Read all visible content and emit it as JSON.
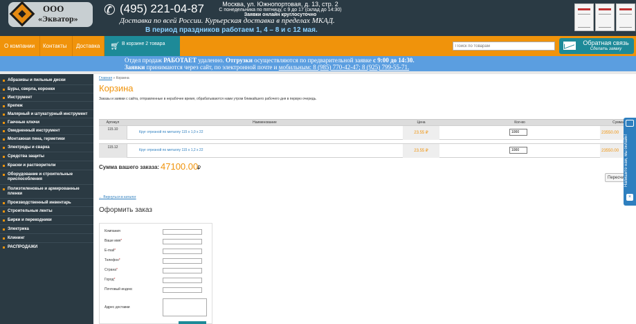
{
  "header": {
    "logo_ooo": "ООО",
    "logo_name": "«Экватор»",
    "phone": "(495) 221-04-87",
    "delivery": "Доставка по всей России.  Курьерская доставка в пределах МКАД.",
    "address": "Москва, ул. Южнопортовая, д. 13, стр. 2",
    "hours": "С понедельника по пятницу, с 9 до 17 (склад до 14:30)",
    "online": "Заявки онлайн круглосуточно",
    "holiday": "В период праздников работаем   1, 4 – 8 и с 12 мая."
  },
  "nav": {
    "items": [
      "О компании",
      "Контакты",
      "Доставка"
    ],
    "cart_label": "В корзине 2 товара",
    "search_placeholder": "Поиск по товарам",
    "feedback_title": "Обратная связь",
    "feedback_sub": "Сделать заявку"
  },
  "notice": {
    "l1_a": "Отдел продаж ",
    "l1_b": "РАБОТАЕТ",
    "l1_c": " удаленно.    ",
    "l1_d": "Отгрузки",
    "l1_e": " осуществляются по предварительной заявке ",
    "l1_f": "с 9:00 до 14:30.",
    "l2_a": "Заявки",
    "l2_b": " принимаются через сайт, по электронной почте и ",
    "l2_c": "мобильным: 8 (985) 770-42-47;   8 (925) 799-55-71."
  },
  "sidebar": {
    "items": [
      "Абразивы и пильные диски",
      "Буры, сверла, коронки",
      "Инструмент",
      "Крепеж",
      "Малярный и штукатурный инструмент",
      "Гаечные ключи",
      "Омедненный инструмент",
      "Монтажная пена, герметики",
      "Электроды и сварка",
      "Средства защиты",
      "Краски и растворители",
      "Оборудование и строительные приспособления",
      "Полиэтиленовые и армированные пленки",
      "Производственный инвентарь",
      "Строительные ленты",
      "Бирки и перекодники",
      "Электрика",
      "Клининг",
      "РАСПРОДАЖИ"
    ]
  },
  "main": {
    "breadcrumb_home": "Главная",
    "breadcrumb_sep": "»",
    "breadcrumb_current": "Корзина",
    "title": "Корзина",
    "intro": "Заказы и заявки с сайта, отправленные в нерабочее время, обрабатываются нами утром ближайшего рабочего дня в первую очередь.",
    "columns": [
      "Артикул",
      "Наименование",
      "Цена",
      "Кол-во",
      "Сумма"
    ],
    "rows": [
      {
        "article": "115.10",
        "name": "Круг отрезной по металлу 115 х 1,0 х 22",
        "price": "23.55 ₽",
        "qty": "1000",
        "sum": "23550.00"
      },
      {
        "article": "115.12",
        "name": "Круг отрезной по металлу 115 х 1,2 х 22",
        "price": "23.55 ₽",
        "qty": "1000",
        "sum": "23550.00"
      }
    ],
    "total_label": "Сумма вашего заказа:",
    "total_value": "47100.00",
    "total_currency": "₽",
    "recalc_label": "Пересчитать",
    "back_link": "← Вернуться в каталог",
    "checkout_title": "Оформить заказ",
    "form_fields": [
      {
        "label": "Компания",
        "required": ""
      },
      {
        "label": "Ваше имя",
        "required": "*"
      },
      {
        "label": "E-mail",
        "required": "*"
      },
      {
        "label": "Телефон",
        "required": "*"
      },
      {
        "label": "Страна",
        "required": "*"
      },
      {
        "label": "Город",
        "required": "*"
      },
      {
        "label": "Почтовый индекс",
        "required": ""
      }
    ],
    "address_label": "Адрес доставки"
  },
  "side_tab": {
    "text": "Напишите нам, мы онлайн!",
    "close": "×"
  }
}
